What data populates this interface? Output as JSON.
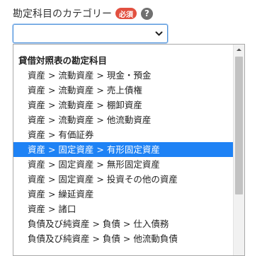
{
  "field": {
    "label": "勘定科目のカテゴリー",
    "required_badge": "必須",
    "help_icon": "?"
  },
  "select": {
    "value": "",
    "icon": "chevron-down-icon"
  },
  "dropdown": {
    "group_label": "貸借対照表の勘定科目",
    "options": [
      "資産 > 流動資産 > 現金・預金",
      "資産 > 流動資産 > 売上債権",
      "資産 > 流動資産 > 棚卸資産",
      "資産 > 流動資産 > 他流動資産",
      "資産 > 有価証券",
      "資産 > 固定資産 > 有形固定資産",
      "資産 > 固定資産 > 無形固定資産",
      "資産 > 固定資産 > 投資その他の資産",
      "資産 > 繰延資産",
      "資産 > 諸口",
      "負債及び純資産 > 負債 > 仕入債務",
      "負債及び純資産 > 負債 > 他流動負債"
    ],
    "selected_index": 5
  },
  "colors": {
    "accent": "#1e82f5",
    "badge": "#e25040"
  }
}
